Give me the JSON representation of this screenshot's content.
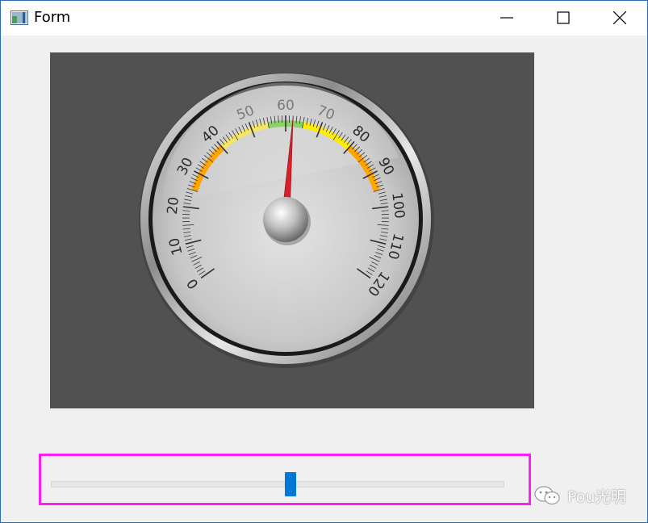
{
  "window": {
    "title": "Form",
    "icon": "app-window-icon",
    "controls": [
      "minimize-icon",
      "maximize-icon",
      "close-icon"
    ]
  },
  "gauge": {
    "value": 62,
    "min": 0,
    "max": 120,
    "tick_labels": [
      "0",
      "10",
      "20",
      "30",
      "40",
      "50",
      "60",
      "70",
      "80",
      "90",
      "100",
      "110",
      "120"
    ],
    "bands": [
      {
        "from": 25,
        "to": 40,
        "color": "#ffa500"
      },
      {
        "from": 40,
        "to": 55,
        "color": "#f3e46a"
      },
      {
        "from": 55,
        "to": 65,
        "color": "#8ad36a"
      },
      {
        "from": 65,
        "to": 80,
        "color": "#ffee00"
      },
      {
        "from": 80,
        "to": 95,
        "color": "#ffa500"
      }
    ],
    "needle_color": "#d8202a"
  },
  "slider": {
    "value": 0.53,
    "track_color": "#e6e6e6",
    "thumb_color": "#0078d7"
  },
  "frame_highlight_color": "#ff1ef2",
  "watermark": {
    "text": "Pou光明",
    "icon": "wechat-icon"
  }
}
